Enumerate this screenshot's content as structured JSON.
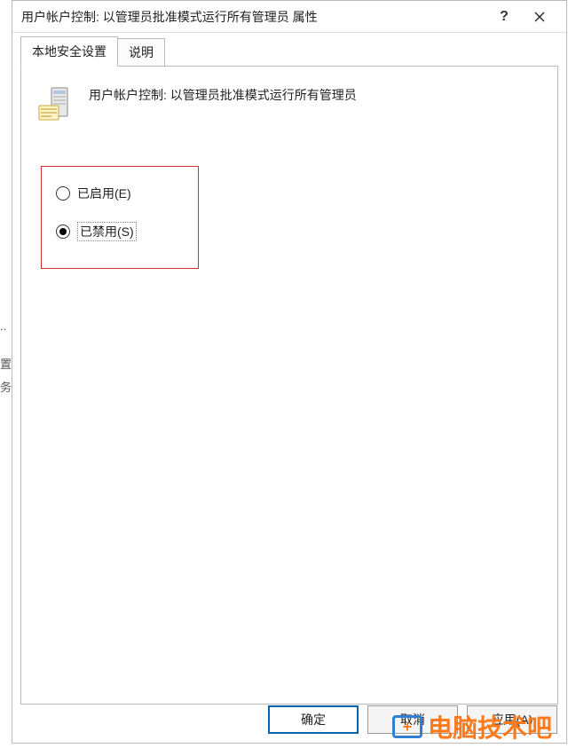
{
  "dialog": {
    "title": "用户帐户控制: 以管理员批准模式运行所有管理员 属性"
  },
  "tabs": {
    "t0": "本地安全设置",
    "t1": "说明"
  },
  "policy": {
    "name": "用户帐户控制: 以管理员批准模式运行所有管理员"
  },
  "options": {
    "enabled": "已启用(E)",
    "disabled": "已禁用(S)",
    "selected": "disabled"
  },
  "buttons": {
    "ok": "确定",
    "cancel": "取消",
    "apply": "应用(A)"
  },
  "watermark": {
    "text": "电脑技术吧"
  }
}
